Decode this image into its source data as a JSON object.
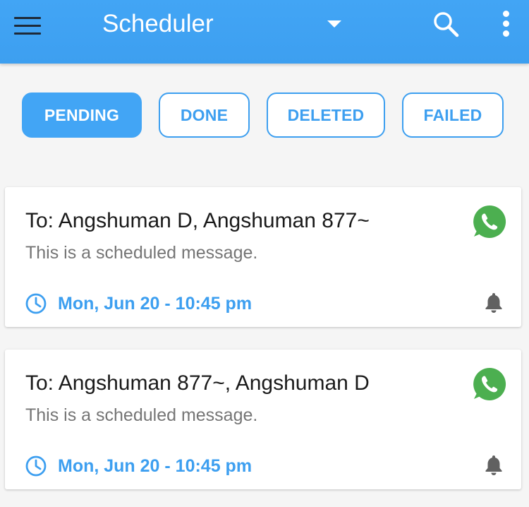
{
  "app_bar": {
    "title": "Scheduler",
    "background_color": "#42a5f5",
    "icons": [
      "menu-icon",
      "dropdown-arrow-icon",
      "search-icon",
      "more-vert-icon"
    ]
  },
  "tabs": [
    {
      "label": "PENDING",
      "active": true
    },
    {
      "label": "DONE",
      "active": false
    },
    {
      "label": "DELETED",
      "active": false
    },
    {
      "label": "FAILED",
      "active": false
    }
  ],
  "messages": [
    {
      "recipients": "To: Angshuman D, Angshuman 877~",
      "body": "This is a scheduled message.",
      "scheduled_time": "Mon, Jun 20 - 10:45 pm",
      "channel_icon": "whatsapp-icon",
      "notify_icon": "bell-icon"
    },
    {
      "recipients": "To: Angshuman 877~, Angshuman D",
      "body": "This is a scheduled message.",
      "scheduled_time": "Mon, Jun 20 - 10:45 pm",
      "channel_icon": "whatsapp-icon",
      "notify_icon": "bell-icon"
    }
  ],
  "colors": {
    "accent": "#3d9ff0",
    "whatsapp_green": "#4caf50",
    "secondary_text": "#757575",
    "bell": "#616161"
  }
}
